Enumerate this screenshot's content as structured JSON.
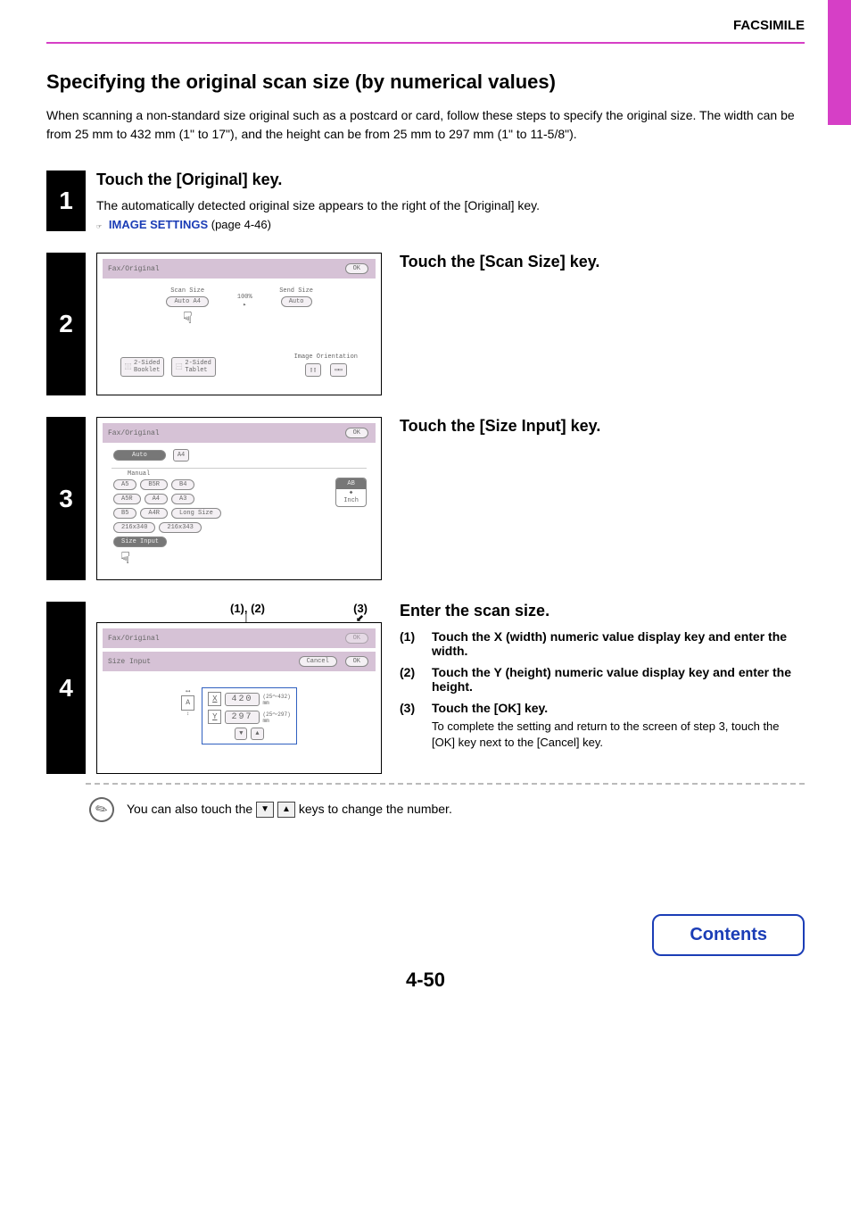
{
  "header": {
    "section": "FACSIMILE",
    "title": "Specifying the original scan size (by numerical values)",
    "intro": "When scanning a non-standard size original such as a postcard or card, follow these steps to specify the original size. The width can be from 25 mm to 432 mm (1\" to 17\"), and the height can be from 25 mm to 297 mm (1\" to 11-5/8\")."
  },
  "step1": {
    "num": "1",
    "title": "Touch the [Original] key.",
    "body": "The automatically detected original size appears to the right of the [Original] key.",
    "link": "IMAGE SETTINGS",
    "link_page": " (page 4-46)"
  },
  "step2": {
    "num": "2",
    "title": "Touch the [Scan Size] key.",
    "screen": {
      "breadcrumb": "Fax/Original",
      "ok": "OK",
      "scan_size_label": "Scan Size",
      "send_size_label": "Send Size",
      "percent": "100%",
      "scan_val": "Auto    A4",
      "send_val": "Auto",
      "orient_label": "Image Orientation",
      "btn_booklet": "2-Sided\nBooklet",
      "btn_tablet": "2-Sided\nTablet"
    }
  },
  "step3": {
    "num": "3",
    "title": "Touch the [Size Input] key.",
    "screen": {
      "breadcrumb": "Fax/Original",
      "ok": "OK",
      "auto": "Auto",
      "auto_tag": "A4",
      "manual": "Manual",
      "sizes_r1": [
        "A5",
        "B5R",
        "B4"
      ],
      "sizes_r2": [
        "A5R",
        "A4",
        "A3"
      ],
      "sizes_r3": [
        "B5",
        "A4R",
        "Long Size"
      ],
      "sizes_r4": [
        "216x340",
        "216x343"
      ],
      "toggle_top": "AB",
      "toggle_bottom": "Inch",
      "size_input": "Size Input"
    }
  },
  "step4": {
    "num": "4",
    "annot_left": "(1), (2)",
    "annot_right": "(3)",
    "title": "Enter the scan size.",
    "screen": {
      "breadcrumb": "Fax/Original",
      "ok_grey": "OK",
      "subbar": "Size Input",
      "cancel": "Cancel",
      "ok": "OK",
      "x_label": "X",
      "x_val": "420",
      "x_range": "(25～432)",
      "y_label": "Y",
      "y_val": "297",
      "y_range": "(25～297)",
      "unit": "mm"
    },
    "sub1_num": "(1)",
    "sub1": "Touch the X (width) numeric value display key and enter the width.",
    "sub2_num": "(2)",
    "sub2": "Touch the Y (height) numeric value display key and enter the height.",
    "sub3_num": "(3)",
    "sub3_lead": "Touch the [OK] key.",
    "sub3_detail": "To complete the setting and return to the screen of step 3, touch the [OK] key next to the [Cancel] key."
  },
  "note": {
    "pre": "You can also touch the ",
    "post": " keys to change the number."
  },
  "footer": {
    "page": "4-50",
    "contents": "Contents"
  }
}
